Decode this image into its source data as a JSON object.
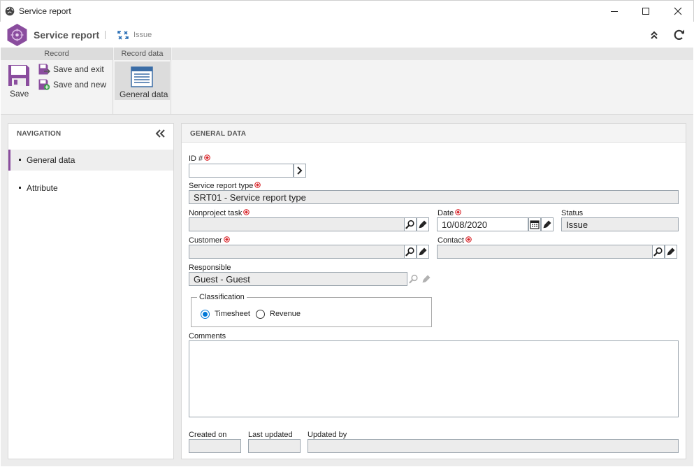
{
  "window": {
    "title": "Service report"
  },
  "header": {
    "app_name": "Service report",
    "context_label": "Issue"
  },
  "ribbon": {
    "groups": [
      {
        "label": "Record"
      },
      {
        "label": "Record data"
      }
    ],
    "save_label": "Save",
    "save_exit_label": "Save and exit",
    "save_new_label": "Save and new",
    "general_data_label": "General data"
  },
  "navigation": {
    "title": "NAVIGATION",
    "items": [
      {
        "label": "General data",
        "active": true
      },
      {
        "label": "Attribute",
        "active": false
      }
    ]
  },
  "form": {
    "title": "GENERAL DATA",
    "id": {
      "label": "ID #",
      "value": ""
    },
    "service_report_type": {
      "label": "Service report type",
      "value": "SRT01 - Service report type"
    },
    "nonproject_task": {
      "label": "Nonproject task",
      "value": ""
    },
    "date": {
      "label": "Date",
      "value": "10/08/2020"
    },
    "status": {
      "label": "Status",
      "value": "Issue"
    },
    "customer": {
      "label": "Customer",
      "value": ""
    },
    "contact": {
      "label": "Contact",
      "value": ""
    },
    "responsible": {
      "label": "Responsible",
      "value": "Guest - Guest"
    },
    "classification": {
      "label": "Classification",
      "options": [
        {
          "label": "Timesheet",
          "selected": true
        },
        {
          "label": "Revenue",
          "selected": false
        }
      ]
    },
    "comments": {
      "label": "Comments",
      "value": ""
    },
    "created_on": {
      "label": "Created on",
      "value": ""
    },
    "last_updated": {
      "label": "Last updated",
      "value": ""
    },
    "updated_by": {
      "label": "Updated by",
      "value": ""
    }
  },
  "colors": {
    "accent": "#8a4d9e",
    "required": "#d9262b",
    "radio": "#0078d7"
  }
}
